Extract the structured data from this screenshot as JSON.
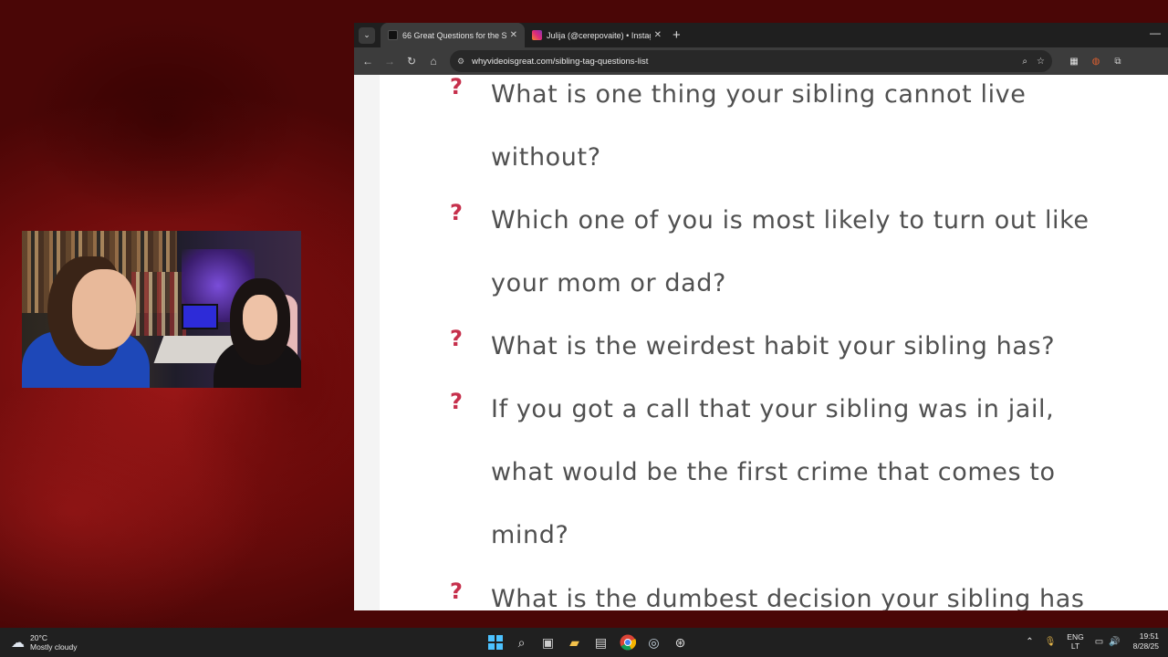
{
  "browser": {
    "tabs": [
      {
        "title": "66 Great Questions for the Sibli",
        "favicon_color": "#111111",
        "active": true
      },
      {
        "title": "Julija (@cerepovaite) • Instagra",
        "favicon_color": "#d62976",
        "active": false
      }
    ],
    "new_tab": "+",
    "url": "whyvideoisgreat.com/sibling-tag-questions-list",
    "icons": {
      "tab_search": "chevron-down-icon",
      "back": "←",
      "forward": "→",
      "reload": "↻",
      "home": "⌂",
      "site_info": "⚙",
      "zoom": "⌕",
      "bookmark": "☆",
      "ext1": "▦",
      "ext2": "◍",
      "extensions": "⧉",
      "minimize": "—",
      "close_tab": "✕"
    }
  },
  "page": {
    "question_mark": "?",
    "questions": [
      {
        "lines": [
          "What is one thing your sibling cannot live",
          "without?"
        ]
      },
      {
        "lines": [
          "Which one of you is most likely to turn out like",
          "your mom or dad?"
        ]
      },
      {
        "lines": [
          "What is the weirdest habit your sibling has?"
        ]
      },
      {
        "lines": [
          "If you got a call that your sibling was in jail,",
          "what would be the first crime that comes to",
          "mind?"
        ]
      },
      {
        "lines": [
          "What is the dumbest decision your sibling has"
        ]
      }
    ],
    "accent_color": "#c6304c"
  },
  "taskbar": {
    "weather_temp": "20°C",
    "weather_desc": "Mostly cloudy",
    "lang_top": "ENG",
    "lang_bottom": "LT",
    "time": "19:51",
    "date": "8/28/25"
  }
}
